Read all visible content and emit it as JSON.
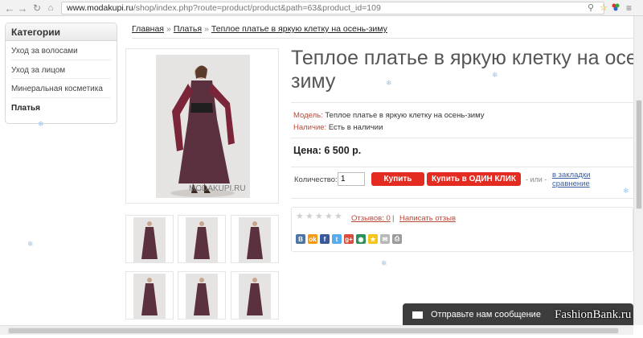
{
  "browser": {
    "url_domain": "www.modakupi.ru",
    "url_path": "/shop/index.php?route=product/product&path=63&product_id=109",
    "back_icon": "arrow-left-icon",
    "forward_icon": "arrow-right-icon",
    "reload_icon": "reload-icon",
    "home_icon": "home-icon"
  },
  "sidebar": {
    "title": "Категории",
    "items": [
      {
        "label": "Уход за волосами"
      },
      {
        "label": "Уход за лицом"
      },
      {
        "label": "Минеральная косметика"
      },
      {
        "label": "Платья",
        "active": true
      }
    ]
  },
  "breadcrumb": {
    "items": [
      "Главная",
      "Платья",
      "Теплое платье в яркую клетку на осень-зиму"
    ],
    "separator": "»"
  },
  "product": {
    "title_line1": "Теплое платье в яркую клетку на осен",
    "title_line2": "зиму",
    "model_label": "Модель:",
    "model_value": "Теплое платье в яркую клетку на осень-зиму",
    "availability_label": "Наличие:",
    "availability_value": "Есть в наличии",
    "price": "Цена: 6 500 р.",
    "image_watermark": "MODAKUPI.RU"
  },
  "buy": {
    "qty_label": "Количество:",
    "qty_value": "1",
    "buy_button": "Купить",
    "one_click_button": "Купить в ОДИН КЛИК",
    "or_text": "- или -",
    "wishlist_link": "в закладки",
    "compare_link": "сравнение"
  },
  "reviews": {
    "reviews_link": "Отзывов: 0",
    "separator": "|",
    "write_link": "Написать отзыв",
    "rating_stars": 0,
    "share_icons": [
      "vk-icon",
      "odnoklassniki-icon",
      "facebook-icon",
      "twitter-icon",
      "google-plus-icon",
      "livejournal-icon",
      "yandex-icon",
      "email-icon",
      "print-icon"
    ]
  },
  "chat": {
    "label": "Отправьте нам сообщение"
  },
  "overlay": {
    "watermark": "FashionBank.ru"
  },
  "colors": {
    "accent_red": "#e32b22",
    "label_red": "#b84a3a",
    "chat_bg": "#3d3d3d"
  }
}
